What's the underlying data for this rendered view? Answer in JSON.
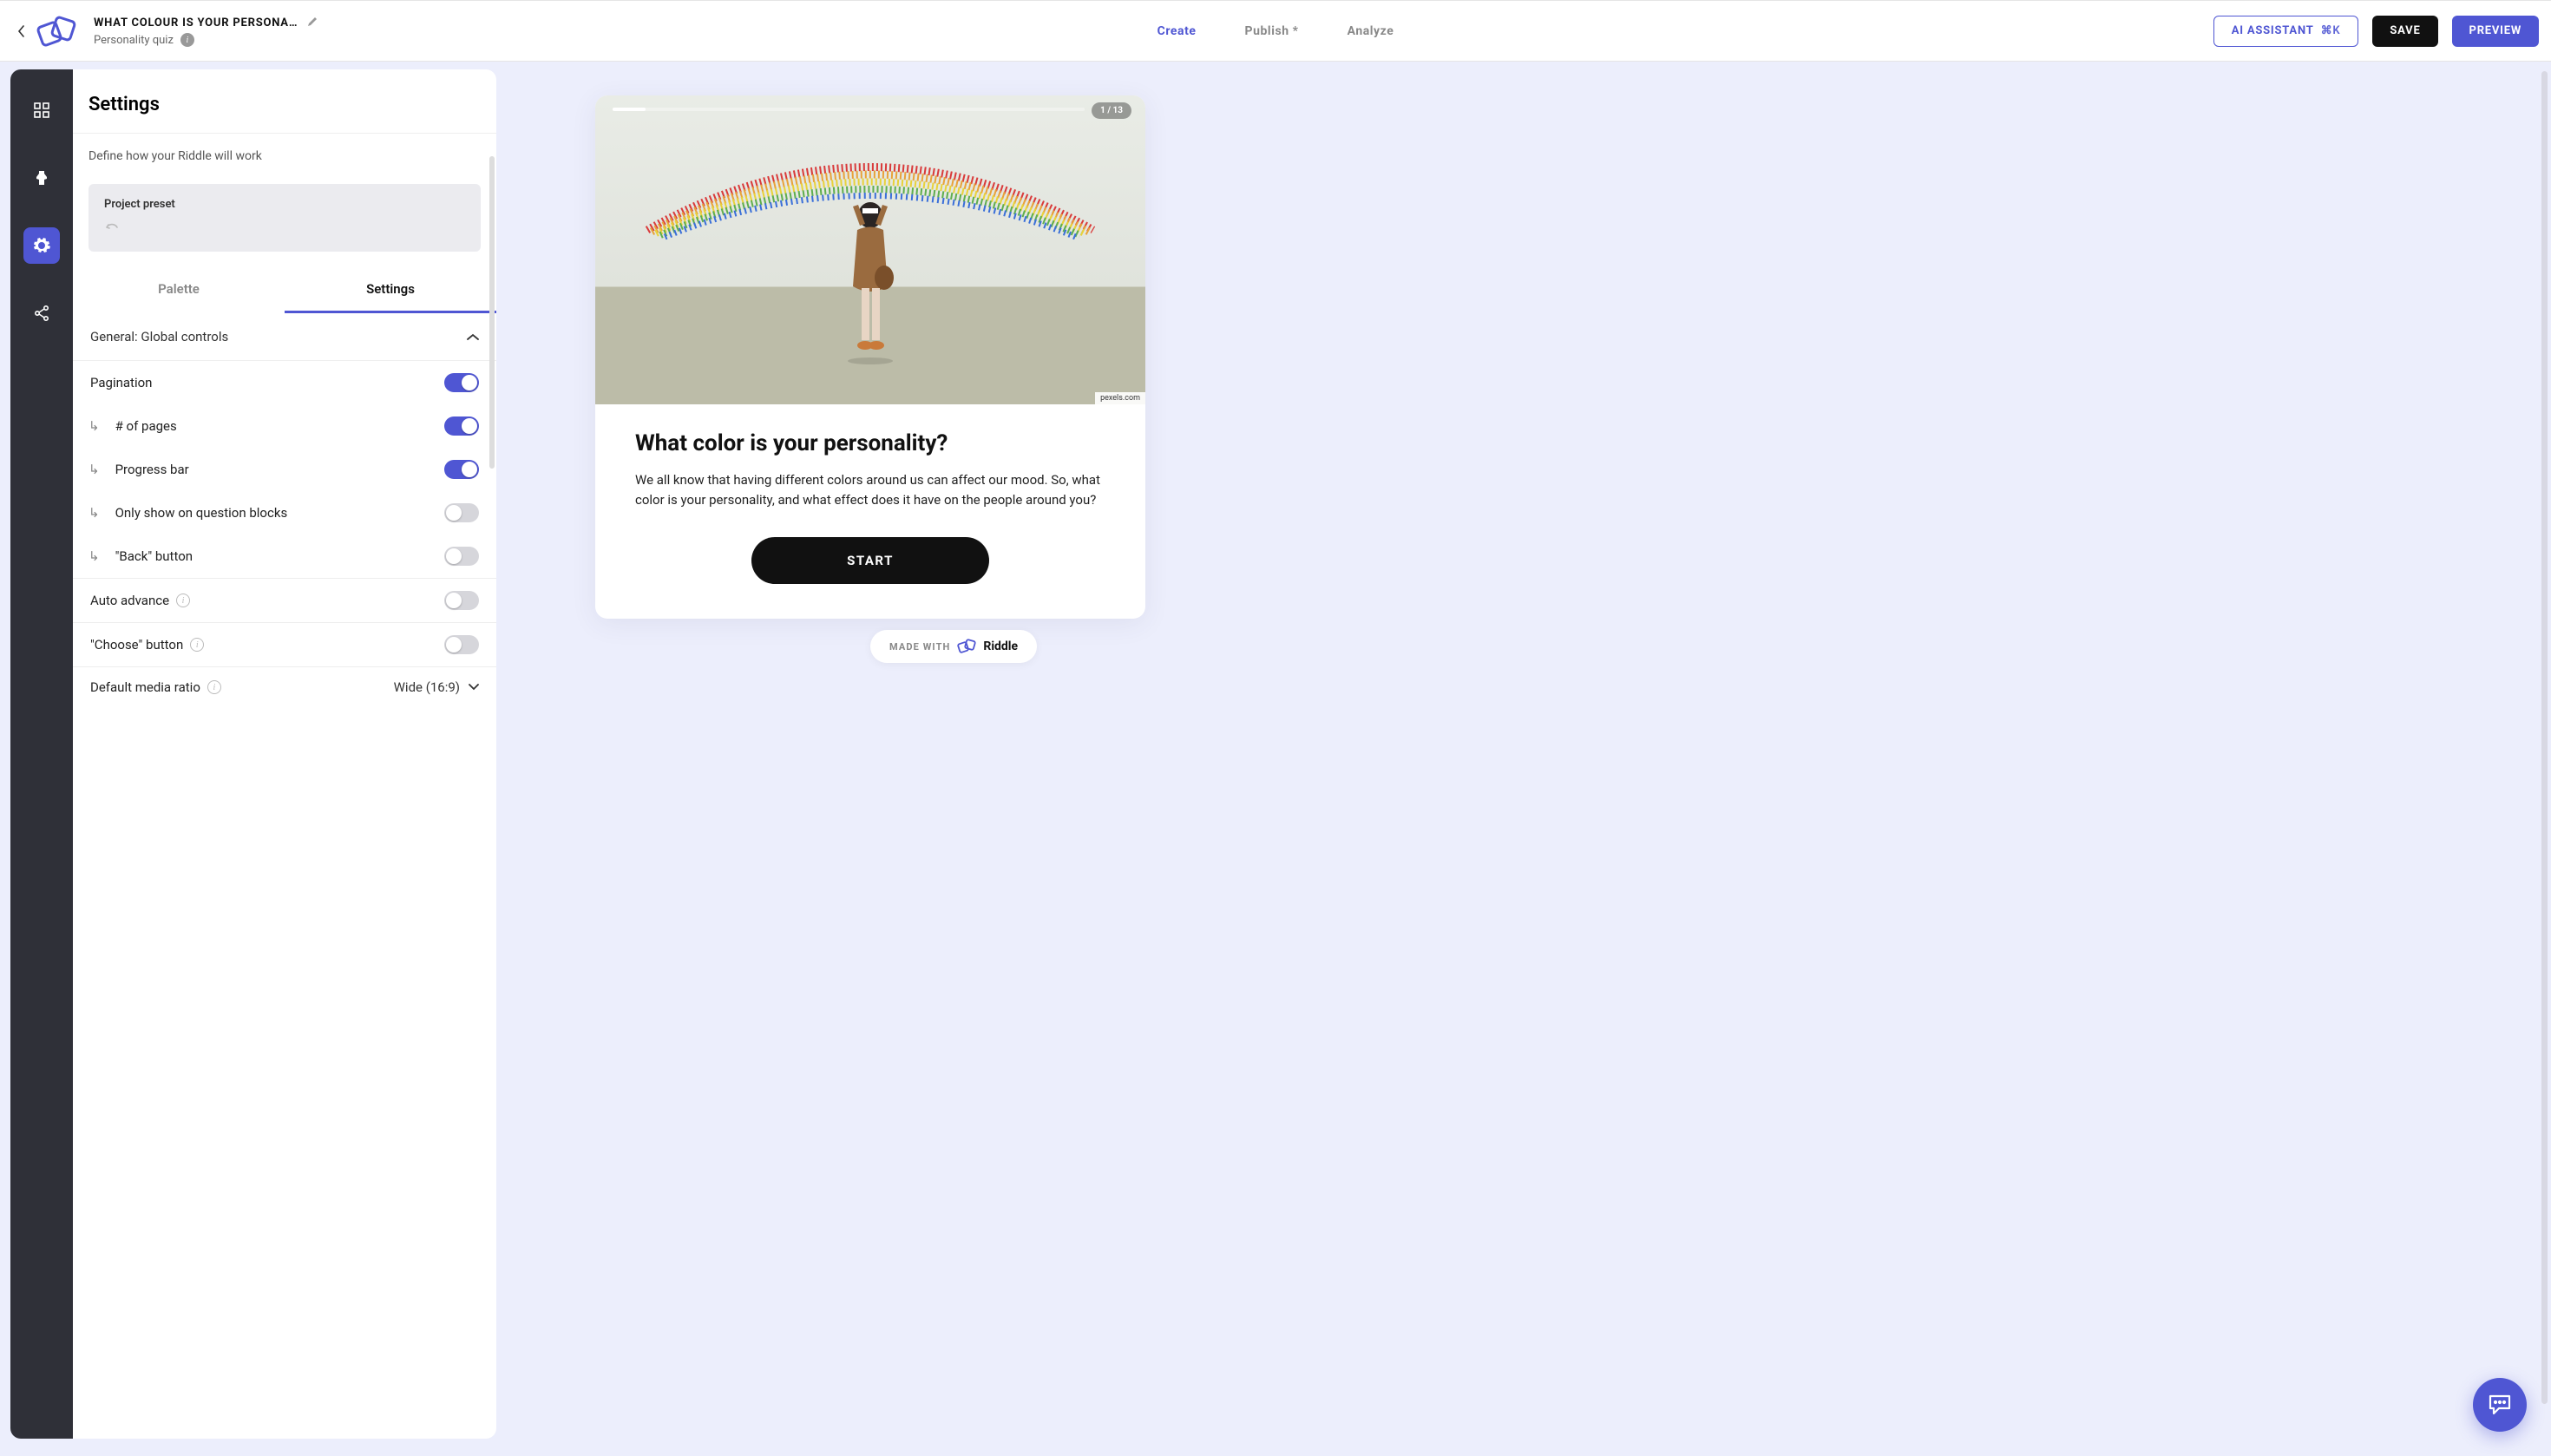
{
  "header": {
    "title": "WHAT COLOUR IS YOUR PERSONA…",
    "subtitle": "Personality quiz",
    "tabs": {
      "create": "Create",
      "publish": "Publish *",
      "analyze": "Analyze"
    },
    "ai_label": "AI ASSISTANT",
    "ai_kbd": "⌘K",
    "save": "SAVE",
    "preview": "PREVIEW"
  },
  "panel": {
    "heading": "Settings",
    "subheading": "Define how your Riddle will work",
    "preset_label": "Project preset",
    "subtabs": {
      "palette": "Palette",
      "settings": "Settings"
    },
    "accordion": "General: Global controls",
    "rows": {
      "pagination": "Pagination",
      "num_pages": "# of pages",
      "progress_bar": "Progress bar",
      "only_q": "Only show on question blocks",
      "back_btn": "\"Back\" button",
      "auto_adv": "Auto advance",
      "choose_btn": "\"Choose\" button",
      "media_ratio": "Default media ratio"
    },
    "media_ratio_value": "Wide (16:9)",
    "toggles": {
      "pagination": true,
      "num_pages": true,
      "progress_bar": true,
      "only_q": false,
      "back_btn": false,
      "auto_adv": false,
      "choose_btn": false
    }
  },
  "preview": {
    "page_counter": "1 / 13",
    "img_credit": "pexels.com",
    "title": "What color is your personality?",
    "desc": "We all know that having different colors around us can affect our mood. So, what color is your personality, and what effect does it have on the people around you?",
    "start": "START"
  },
  "footer": {
    "made_with": "MADE WITH",
    "brand": "Riddle"
  }
}
